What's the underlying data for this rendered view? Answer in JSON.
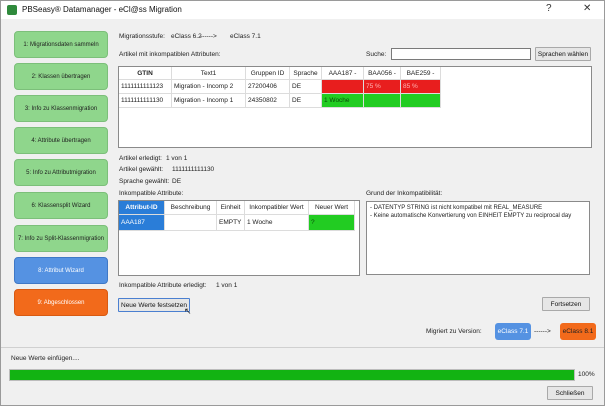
{
  "window": {
    "title": "PBSeasy® Datamanager - eCl@ss Migration",
    "help_glyph": "?",
    "close_glyph": "✕"
  },
  "steps": [
    {
      "label": "1: Migrationsdaten sammeln",
      "state": "done"
    },
    {
      "label": "2: Klassen übertragen",
      "state": "done"
    },
    {
      "label": "3: Info zu Klassenmigration",
      "state": "done"
    },
    {
      "label": "4: Attribute übertragen",
      "state": "done"
    },
    {
      "label": "5: Info zu Attributmigration",
      "state": "done"
    },
    {
      "label": "6: Klassensplit Wizard",
      "state": "done"
    },
    {
      "label": "7: Info zu Split-Klassenmigration",
      "state": "done"
    },
    {
      "label": "8: Attribut Wizard",
      "state": "active"
    },
    {
      "label": "9: Abgeschlossen",
      "state": "final"
    }
  ],
  "migration": {
    "label": "Migrationsstufe:",
    "from": "eClass 6.2",
    "arrow": "------>",
    "to": "eClass 7.1"
  },
  "articles_section": {
    "heading": "Artikel mit inkompatiblen Attributen:",
    "search_label": "Suche:",
    "search_value": "",
    "language_button": "Sprachen wählen",
    "columns": [
      "GTIN",
      "Text1",
      "Gruppen ID",
      "Sprache",
      "AAA187 -",
      "BAA056 -",
      "BAE259 -"
    ],
    "rows": [
      [
        "1111111111123",
        "Migration - Incomp 2",
        "27200406",
        "DE",
        "",
        "75 %",
        "85 %"
      ],
      [
        "1111111111130",
        "Migration - Incomp 1",
        "24350802",
        "DE",
        "1 Woche",
        "",
        ""
      ]
    ]
  },
  "status": {
    "done_label": "Artikel erledigt:",
    "done_value": "1 von 1",
    "selected_label": "Artikel gewählt:",
    "selected_value": "1111111111130",
    "language_label": "Sprache gewählt:",
    "language_value": "DE"
  },
  "incompatible": {
    "heading": "Inkompatible Attribute:",
    "columns": [
      "Attribut-ID",
      "Beschreibung",
      "Einheit",
      "Inkompatibler Wert",
      "Neuer Wert"
    ],
    "row": [
      "AAA187",
      "",
      "EMPTY",
      "1 Woche",
      "?"
    ],
    "done_label": "Inkompatible Attribute erledigt:",
    "done_value": "1 von 1"
  },
  "reason": {
    "heading": "Grund der Inkompatibilität:",
    "lines": [
      "- DATENTYP STRING ist nicht kompatibel mit REAL_MEASURE",
      "- Keine automatische Konvertierung von EINHEIT EMPTY zu reciprocal day"
    ]
  },
  "buttons": {
    "set_values": "Neue Werte festsetzen",
    "continue": "Fortsetzen",
    "close": "Schließen"
  },
  "versions": {
    "label": "Migriert zu Version:",
    "from": "eClass 7.1",
    "arrow": "------>",
    "to": "eClass 8.1"
  },
  "progress": {
    "label": "Neue Werte einfügen....",
    "percent_text": "100%",
    "value": 1.0
  },
  "colors": {
    "done": "#8fd68c",
    "active": "#5592e2",
    "final": "#f26a1b",
    "red": "#e81e1e",
    "green": "#22cc22",
    "progress": "#12b312"
  }
}
